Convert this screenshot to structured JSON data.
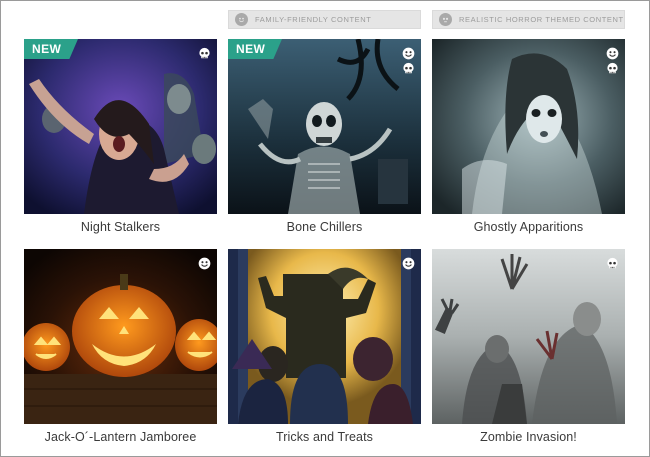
{
  "legend": {
    "family_label": "FAMILY-FRIENDLY CONTENT",
    "horror_label": "REALISTIC HORROR THEMED CONTENT"
  },
  "badge_new": "NEW",
  "colors": {
    "accent_new": "#2ba18a",
    "legend_bg": "#e5e5e5",
    "legend_text": "#9c9c9c"
  },
  "cards": [
    {
      "title": "Night Stalkers",
      "new": true,
      "icons": [
        "skull-icon"
      ]
    },
    {
      "title": "Bone Chillers",
      "new": true,
      "icons": [
        "smiley-icon",
        "skull-icon"
      ]
    },
    {
      "title": "Ghostly Apparitions",
      "new": false,
      "icons": [
        "smiley-icon",
        "skull-icon"
      ]
    },
    {
      "title": "Jack-O´-Lantern Jamboree",
      "new": false,
      "icons": [
        "smiley-icon"
      ]
    },
    {
      "title": "Tricks and Treats",
      "new": false,
      "icons": [
        "smiley-icon"
      ]
    },
    {
      "title": "Zombie Invasion!",
      "new": false,
      "icons": [
        "skull-icon"
      ]
    }
  ]
}
